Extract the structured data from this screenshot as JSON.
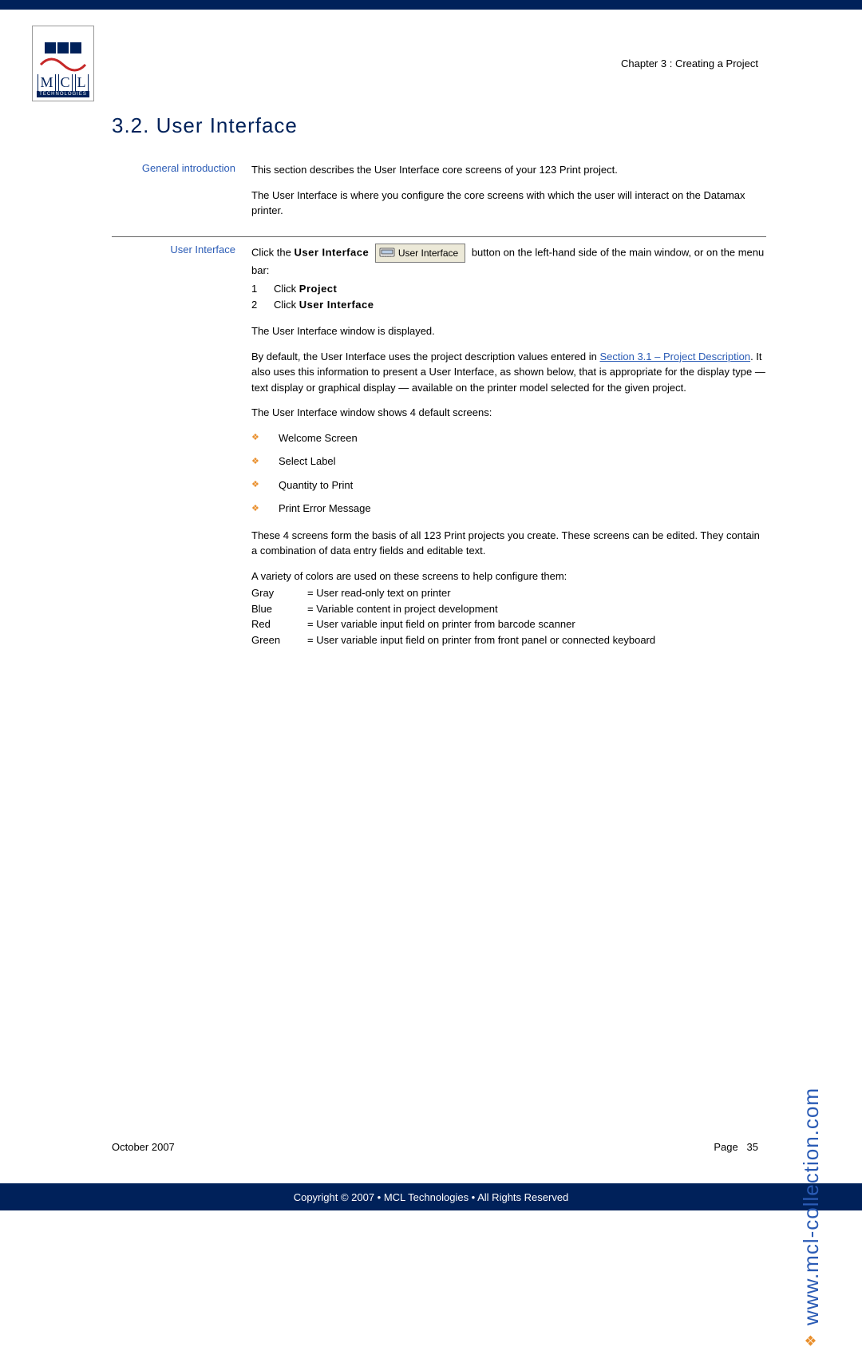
{
  "chapter": "Chapter 3 : Creating a Project",
  "heading": "3.2. User Interface",
  "label_general": "General introduction",
  "intro_p1": "This section describes the User Interface core screens of your 123 Print project.",
  "intro_p2": "The User Interface is where you configure the core screens with which the user will interact on the Datamax printer.",
  "label_ui": "User Interface",
  "ui_click_pre": "Click the ",
  "ui_click_bold": "User Interface",
  "ui_button_text": "User Interface",
  "ui_click_post": " button on the left-hand side of the main window, or on the menu bar:",
  "step1_n": "1",
  "step1_t": "Click Project",
  "step2_n": "2",
  "step2_t": "Click User Interface",
  "displayed": "The User Interface window is displayed.",
  "defaults_pre": "By default, the User Interface uses the project description values entered in ",
  "defaults_link": "Section 3.1 – Project Description",
  "defaults_post": ".  It also uses this information to present a User Interface, as shown below, that is appropriate for the display type — text display or graphical display — available on the printer model selected for the given project.",
  "four_intro": "The User Interface window shows 4 default screens:",
  "screens": {
    "s1": "Welcome Screen",
    "s2": "Select Label",
    "s3": "Quantity to Print",
    "s4": "Print Error Message"
  },
  "four_basis": "These 4 screens form the basis of all 123 Print projects you create. These screens can be edited. They contain a combination of data entry fields and editable text.",
  "colors_intro": "A variety of colors are used on these screens to help configure them:",
  "colors": {
    "c1n": "Gray",
    "c1m": "= User read-only text on printer",
    "c2n": "Blue",
    "c2m": "= Variable content in project development",
    "c3n": "Red",
    "c3m": "= User variable input field on printer from barcode scanner",
    "c4n": "Green",
    "c4m": "= User variable input field on printer from front panel or connected keyboard"
  },
  "footer_date": "October 2007",
  "footer_page_label": "Page",
  "footer_page_num": "35",
  "copyright": "Copyright © 2007 • MCL Technologies • All Rights Reserved",
  "side_url": "www.mcl-collection.com",
  "logo_tech": "TECHNOLOGIES"
}
